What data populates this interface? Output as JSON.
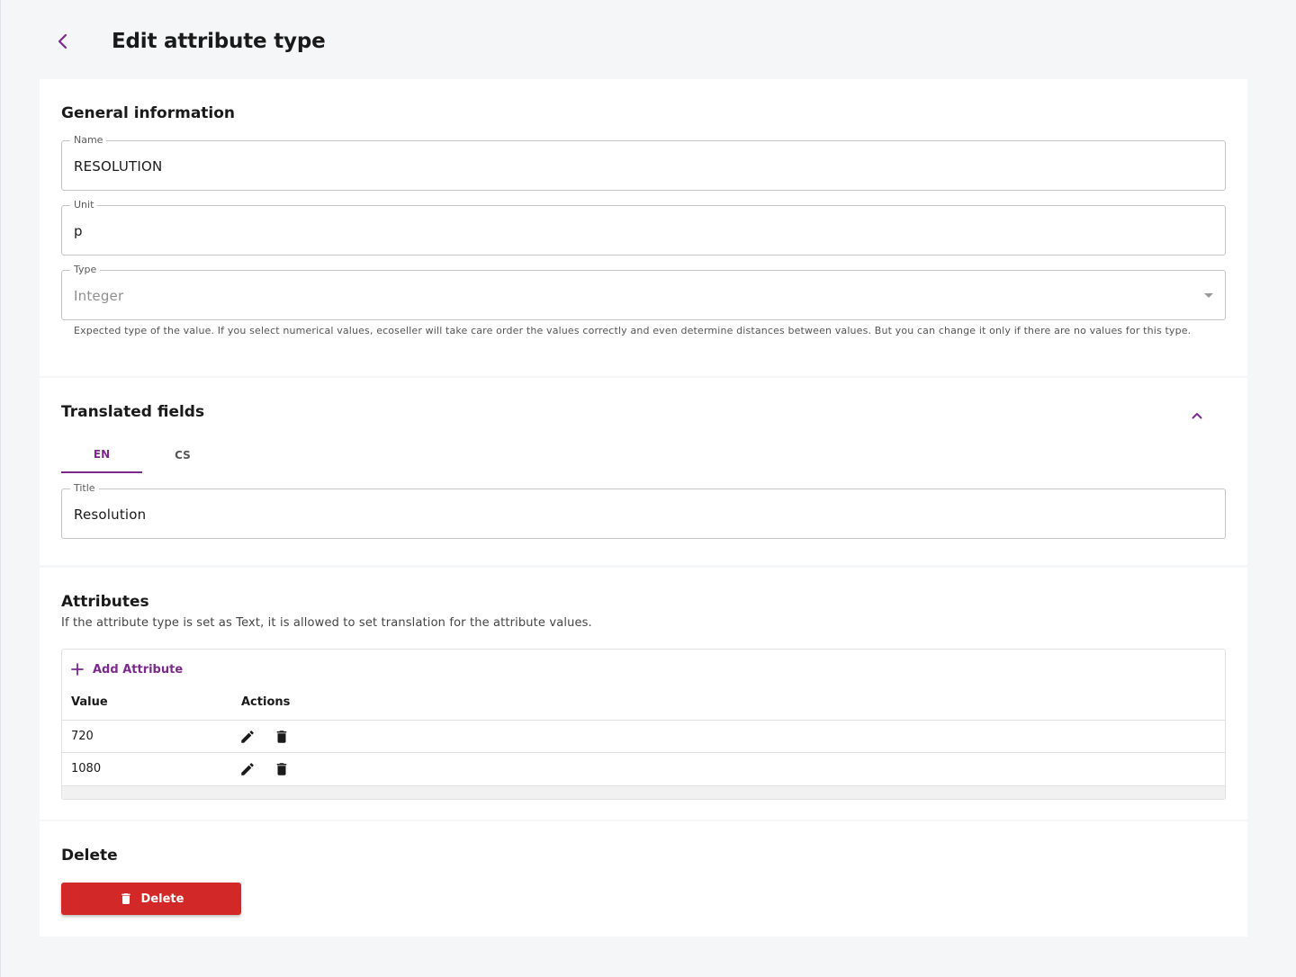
{
  "colors": {
    "accent": "#7b2a8c",
    "danger": "#d32828",
    "background": "#f5f6f8"
  },
  "header": {
    "title": "Edit attribute type",
    "back_icon": "chevron-left-icon"
  },
  "general": {
    "title": "General information",
    "name": {
      "label": "Name",
      "value": "RESOLUTION"
    },
    "unit": {
      "label": "Unit",
      "value": "p"
    },
    "type": {
      "label": "Type",
      "value": "Integer",
      "helper": "Expected type of the value. If you select numerical values, ecoseller will take care order the values correctly and even determine distances between values. But you can change it only if there are no values for this type."
    }
  },
  "translated": {
    "title": "Translated fields",
    "tabs": [
      {
        "label": "EN",
        "active": true
      },
      {
        "label": "CS",
        "active": false
      }
    ],
    "title_field": {
      "label": "Title",
      "value": "Resolution"
    }
  },
  "attributes": {
    "title": "Attributes",
    "description": "If the attribute type is set as Text, it is allowed to set translation for the attribute values.",
    "add_label": "Add Attribute",
    "columns": [
      "Value",
      "Actions"
    ],
    "rows": [
      {
        "value": "720"
      },
      {
        "value": "1080"
      }
    ]
  },
  "delete_section": {
    "title": "Delete",
    "button_label": "Delete"
  }
}
